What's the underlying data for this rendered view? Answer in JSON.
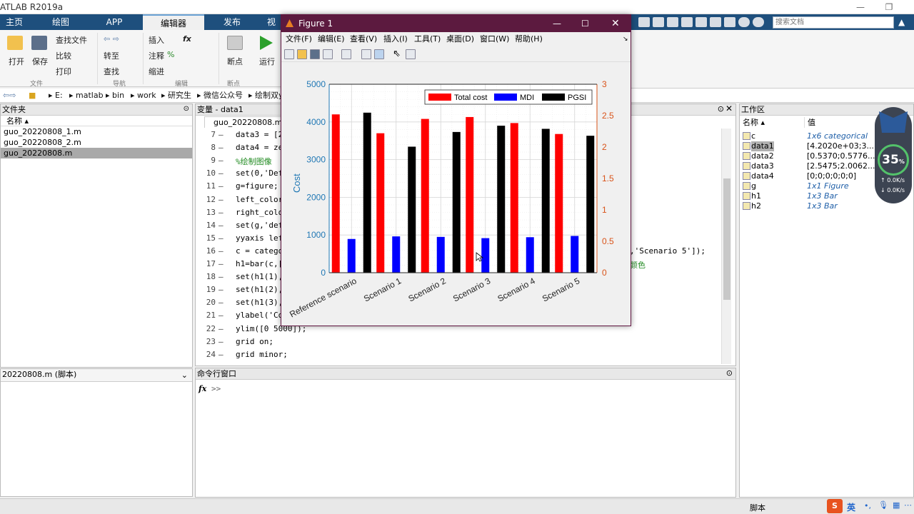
{
  "window": {
    "title": "ATLAB R2019a"
  },
  "ribbon_tabs": [
    "主页",
    "绘图",
    "APP",
    "编辑器",
    "发布",
    "视"
  ],
  "ribbon": {
    "open": "打开",
    "save": "保存",
    "find_files": "查找文件",
    "compare": "比较",
    "print": "打印",
    "goto": "转至",
    "find": "查找",
    "insert": "插入",
    "comment": "注释",
    "indent": "缩进",
    "breakpoint": "断点",
    "run": "运行",
    "groups": {
      "file": "文件",
      "nav": "导航",
      "edit": "编辑",
      "bp": "断点"
    }
  },
  "search": {
    "placeholder": "搜索文档"
  },
  "address": {
    "segments": [
      "E:",
      "matlab",
      "bin",
      "work",
      "研究生",
      "微信公众号",
      "绘制双y"
    ]
  },
  "files_panel": {
    "title": "文件夹",
    "col_name": "名称",
    "files": [
      "guo_20220808_1.m",
      "guo_20220808_2.m",
      "guo_20220808.m"
    ],
    "detail": "20220808.m  (脚本)"
  },
  "var_tab": {
    "label": "变量 - data1"
  },
  "editor": {
    "tab": "guo_20220808.m",
    "lines": [
      {
        "n": "7",
        "code": "data3 = [2"
      },
      {
        "n": "8",
        "code": "data4 = ze"
      },
      {
        "n": "9",
        "code": "%绘制图像"
      },
      {
        "n": "10",
        "code": "set(0,'Def"
      },
      {
        "n": "11",
        "code": "g=figure;"
      },
      {
        "n": "12",
        "code": "left_color"
      },
      {
        "n": "13",
        "code": "right_colo"
      },
      {
        "n": "14",
        "code": "set(g,'def"
      },
      {
        "n": "15",
        "code": "yyaxis lef"
      },
      {
        "n": "16",
        "code": "c = catego"
      },
      {
        "n": "17",
        "code": "h1=bar(c,["
      },
      {
        "n": "18",
        "code": "set(h1(1),"
      },
      {
        "n": "19",
        "code": "set(h1(2),"
      },
      {
        "n": "20",
        "code": "set(h1(3),"
      },
      {
        "n": "21",
        "code": "ylabel('Co"
      },
      {
        "n": "22",
        "code": "ylim([0 5000]);"
      },
      {
        "n": "23",
        "code": "grid on;"
      },
      {
        "n": "24",
        "code": "grid minor;"
      }
    ],
    "right_line16": ",'Scenario 5']);",
    "right_line17": "颜色"
  },
  "command_window": {
    "title": "命令行窗口",
    "prompt": ">>",
    "fx": "fx"
  },
  "workspace": {
    "title": "工作区",
    "col_name": "名称",
    "col_value": "值",
    "rows": [
      {
        "name": "c",
        "value": "1x6 categorical"
      },
      {
        "name": "data1",
        "value": "[4.2020e+03;3...."
      },
      {
        "name": "data2",
        "value": "[0.5370;0.5776..."
      },
      {
        "name": "data3",
        "value": "[2.5475;2.0062..."
      },
      {
        "name": "data4",
        "value": "[0;0;0;0;0;0]"
      },
      {
        "name": "g",
        "value": "1x1 Figure"
      },
      {
        "name": "h1",
        "value": "1x3 Bar"
      },
      {
        "name": "h2",
        "value": "1x3 Bar"
      }
    ]
  },
  "status": {
    "mode": "脚本"
  },
  "ime": {
    "lang": "英"
  },
  "gauge": {
    "percent": "35",
    "unit": "%",
    "up": "0.0",
    "down": "0.0",
    "rate_unit": "K/s"
  },
  "figure": {
    "title": "Figure 1",
    "menu": [
      "文件(F)",
      "编辑(E)",
      "查看(V)",
      "插入(I)",
      "工具(T)",
      "桌面(D)",
      "窗口(W)",
      "帮助(H)"
    ]
  },
  "colors": {
    "left_axis": "#1f77b4",
    "right_axis": "#d95319",
    "total_cost": "#ff0000",
    "mdi": "#0000ff",
    "pgsi": "#000000"
  },
  "chart_data": {
    "type": "bar",
    "categories": [
      "Reference scenario",
      "Scenario 1",
      "Scenario 2",
      "Scenario 3",
      "Scenario 4",
      "Scenario 5"
    ],
    "series": [
      {
        "name": "Total cost",
        "axis": "left",
        "values": [
          4200,
          3700,
          4080,
          4130,
          3970,
          3680
        ]
      },
      {
        "name": "MDI",
        "axis": "right",
        "values": [
          0.537,
          0.578,
          0.57,
          0.55,
          0.565,
          0.585
        ]
      },
      {
        "name": "PGSI",
        "axis": "right",
        "values": [
          2.5475,
          2.0062,
          2.24,
          2.34,
          2.29,
          2.18
        ]
      }
    ],
    "ylabel": "Cost",
    "ylim_left": [
      0,
      5000
    ],
    "ylim_right": [
      0,
      3
    ],
    "yticks_left": [
      "0",
      "1000",
      "2000",
      "3000",
      "4000",
      "5000"
    ],
    "yticks_right": [
      "0",
      "0.5",
      "1",
      "1.5",
      "2",
      "2.5",
      "3"
    ],
    "legend_position": "top-right",
    "grid": "minor"
  }
}
